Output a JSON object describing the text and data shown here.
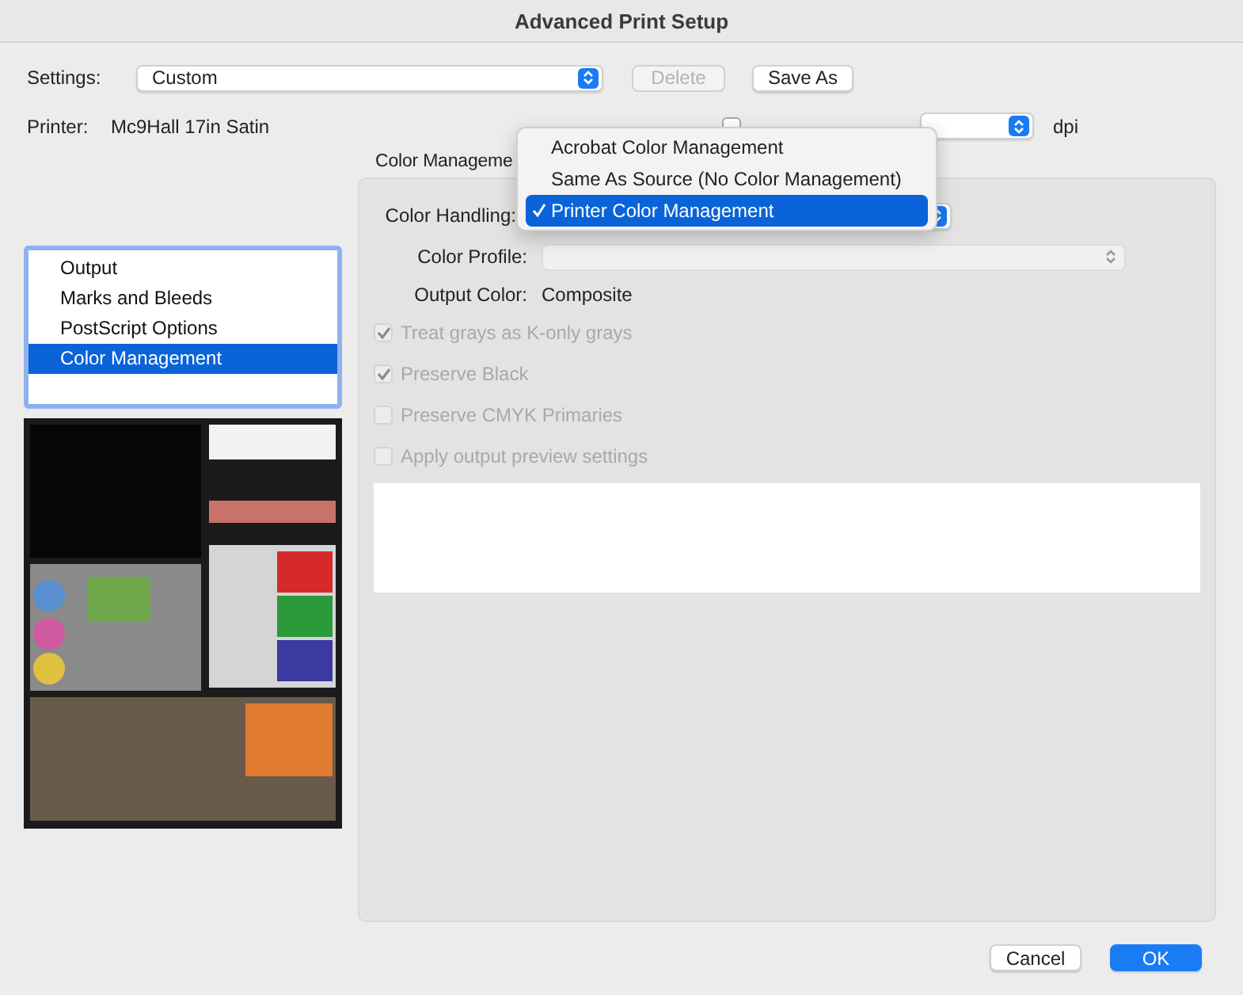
{
  "window": {
    "title": "Advanced Print Setup"
  },
  "settings": {
    "label": "Settings:",
    "value": "Custom",
    "buttons": [
      {
        "label": "Delete",
        "disabled": true
      },
      {
        "label": "Save As",
        "disabled": false
      }
    ]
  },
  "printer": {
    "label": "Printer:",
    "value": "Mc9Hall 17in Satin"
  },
  "resolution": {
    "checked": false,
    "unit": "dpi"
  },
  "sections": [
    {
      "label": "Output",
      "selected": false
    },
    {
      "label": "Marks and Bleeds",
      "selected": false
    },
    {
      "label": "PostScript Options",
      "selected": false
    },
    {
      "label": "Color Management",
      "selected": true
    }
  ],
  "group": {
    "title": "Color Manageme"
  },
  "color_handling": {
    "label": "Color Handling:",
    "menu": [
      {
        "label": "Acrobat Color Management",
        "selected": false
      },
      {
        "label": "Same As Source (No Color Management)",
        "selected": false
      },
      {
        "label": "Printer Color Management",
        "selected": true
      }
    ]
  },
  "color_profile": {
    "label": "Color Profile:",
    "disabled": true
  },
  "output_color": {
    "label": "Output Color:",
    "value": "Composite"
  },
  "options": [
    {
      "label": "Treat grays as K-only grays",
      "checked": true,
      "disabled": true
    },
    {
      "label": "Preserve Black",
      "checked": true,
      "disabled": true
    },
    {
      "label": "Preserve CMYK Primaries",
      "checked": false,
      "disabled": true
    },
    {
      "label": "Apply output preview settings",
      "checked": false,
      "disabled": true
    }
  ],
  "footer_buttons": [
    {
      "label": "Cancel",
      "primary": false
    },
    {
      "label": "OK",
      "primary": true
    }
  ]
}
